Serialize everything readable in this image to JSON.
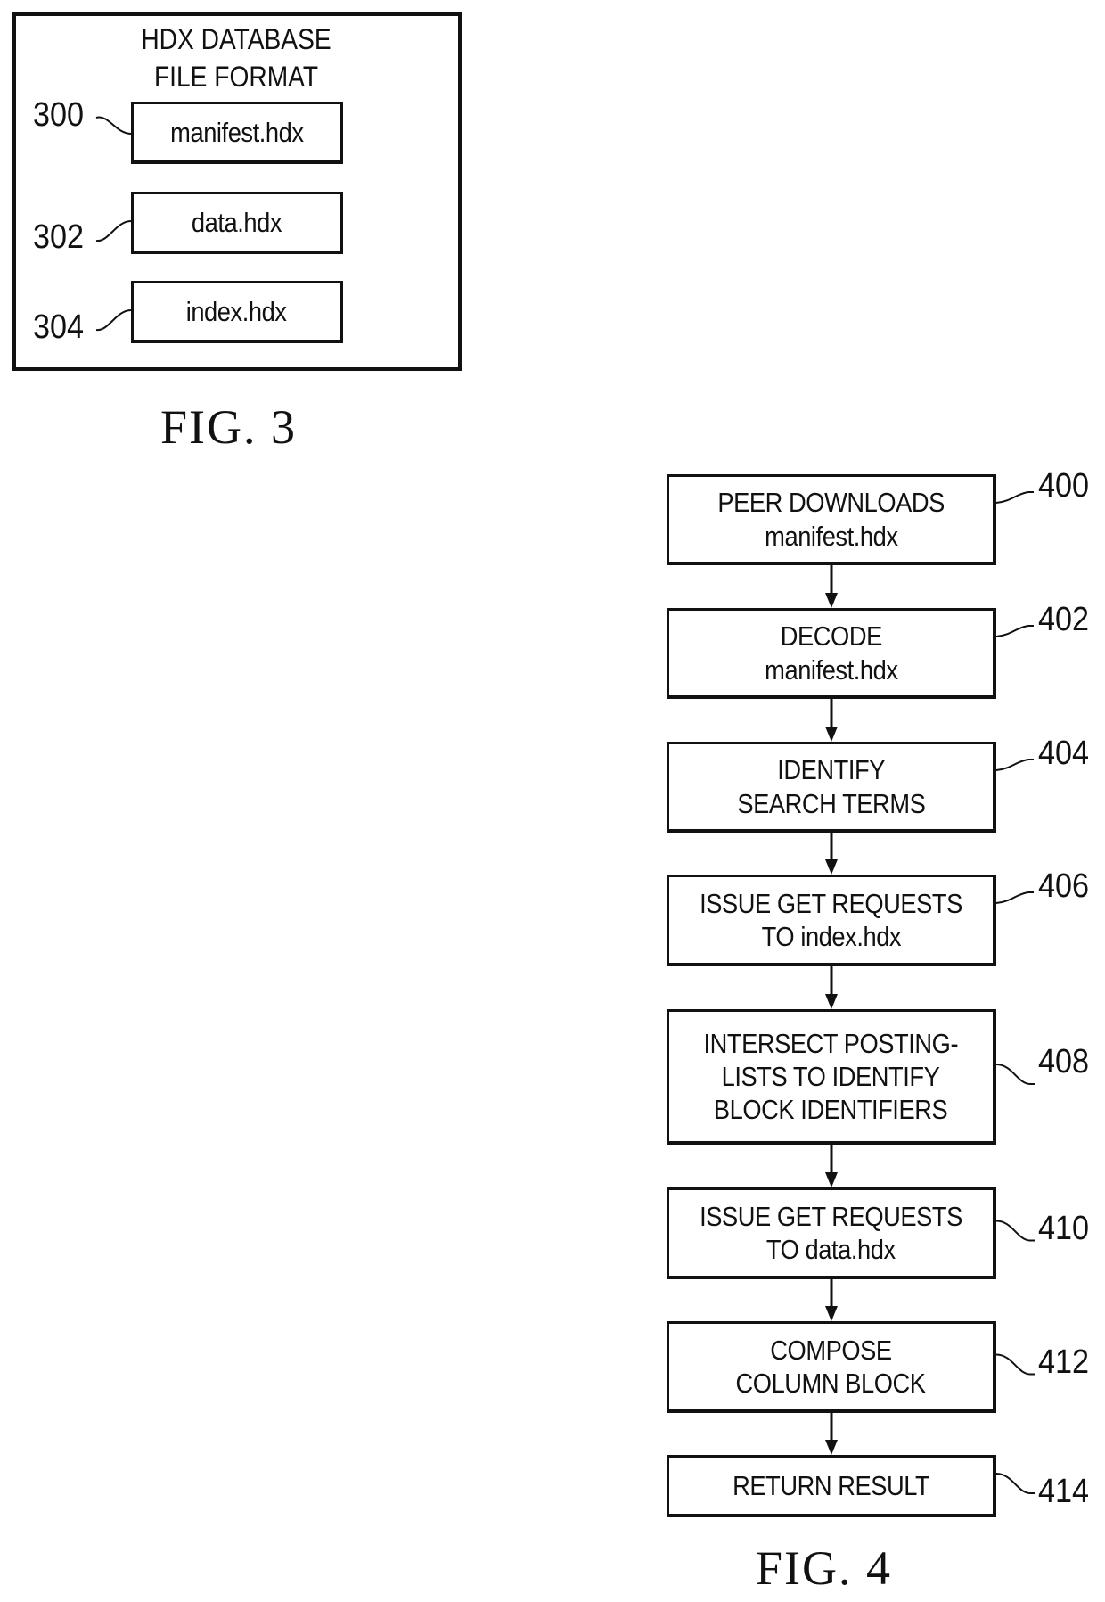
{
  "fig3": {
    "caption": "FIG. 3",
    "container_title": [
      "HDX DATABASE",
      "FILE FORMAT"
    ],
    "files": [
      {
        "ref": "300",
        "label": "manifest.hdx"
      },
      {
        "ref": "302",
        "label": "data.hdx"
      },
      {
        "ref": "304",
        "label": "index.hdx"
      }
    ]
  },
  "fig4": {
    "caption": "FIG. 4",
    "steps": [
      {
        "ref": "400",
        "lines": [
          "PEER DOWNLOADS",
          "manifest.hdx"
        ]
      },
      {
        "ref": "402",
        "lines": [
          "DECODE",
          "manifest.hdx"
        ]
      },
      {
        "ref": "404",
        "lines": [
          "IDENTIFY",
          "SEARCH TERMS"
        ]
      },
      {
        "ref": "406",
        "lines": [
          "ISSUE GET REQUESTS",
          "TO index.hdx"
        ]
      },
      {
        "ref": "408",
        "lines": [
          "INTERSECT POSTING-",
          "LISTS TO IDENTIFY",
          "BLOCK IDENTIFIERS"
        ]
      },
      {
        "ref": "410",
        "lines": [
          "ISSUE GET REQUESTS",
          "TO data.hdx"
        ]
      },
      {
        "ref": "412",
        "lines": [
          "COMPOSE",
          "COLUMN BLOCK"
        ]
      },
      {
        "ref": "414",
        "lines": [
          "RETURN RESULT"
        ]
      }
    ]
  }
}
